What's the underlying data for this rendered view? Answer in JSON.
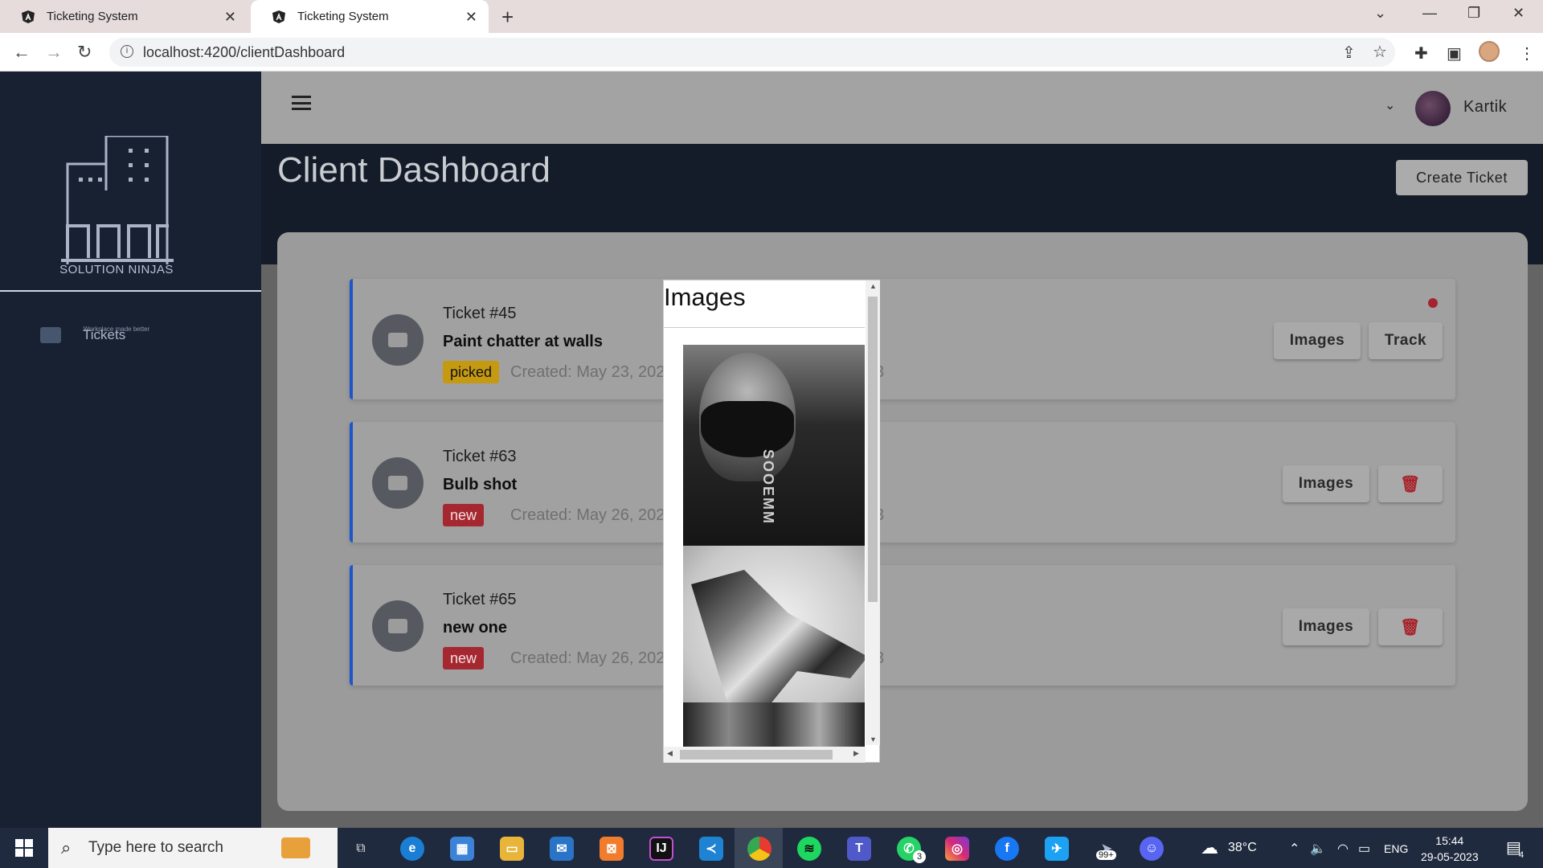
{
  "browser": {
    "tabs": [
      {
        "title": "Ticketing System",
        "active": false
      },
      {
        "title": "Ticketing System",
        "active": true
      }
    ],
    "url": "localhost:4200/clientDashboard"
  },
  "sidebar": {
    "logo_text": "SOLUTION NINJAS",
    "logo_tagline": "Workplace made better",
    "items": [
      {
        "label": "Tickets",
        "icon": "ticket-icon"
      }
    ]
  },
  "header": {
    "user_name": "Kartik"
  },
  "page": {
    "title": "Client Dashboard",
    "create_button": "Create Ticket"
  },
  "tickets": [
    {
      "number": "Ticket #45",
      "title": "Paint chatter at walls",
      "status": "picked",
      "created": "Created: May 23, 202",
      "created_tail": "3",
      "actions": [
        "Images",
        "Track"
      ],
      "has_dot": true
    },
    {
      "number": "Ticket #63",
      "title": "Bulb shot",
      "status": "new",
      "created": "Created: May 26, 202",
      "created_tail": "3",
      "actions": [
        "Images",
        "delete-icon"
      ]
    },
    {
      "number": "Ticket #65",
      "title": "new one",
      "status": "new",
      "created": "Created: May 26, 202",
      "created_tail": "3",
      "actions": [
        "Images",
        "delete-icon"
      ]
    }
  ],
  "modal": {
    "title": "Images",
    "images": [
      "photo-person-masked",
      "photo-mechanical-lion"
    ]
  },
  "taskbar": {
    "search_placeholder": "Type here to search",
    "weather": "38°C",
    "language": "ENG",
    "time": "15:44",
    "date": "29-05-2023",
    "whatsapp_badge": "3",
    "telegram_badge": "99+",
    "notification_count": "4"
  },
  "colors": {
    "sidebar_bg": "#172132",
    "accent_border": "#1c56c9",
    "badge_picked": "#c59a11",
    "badge_new": "#a52830"
  }
}
